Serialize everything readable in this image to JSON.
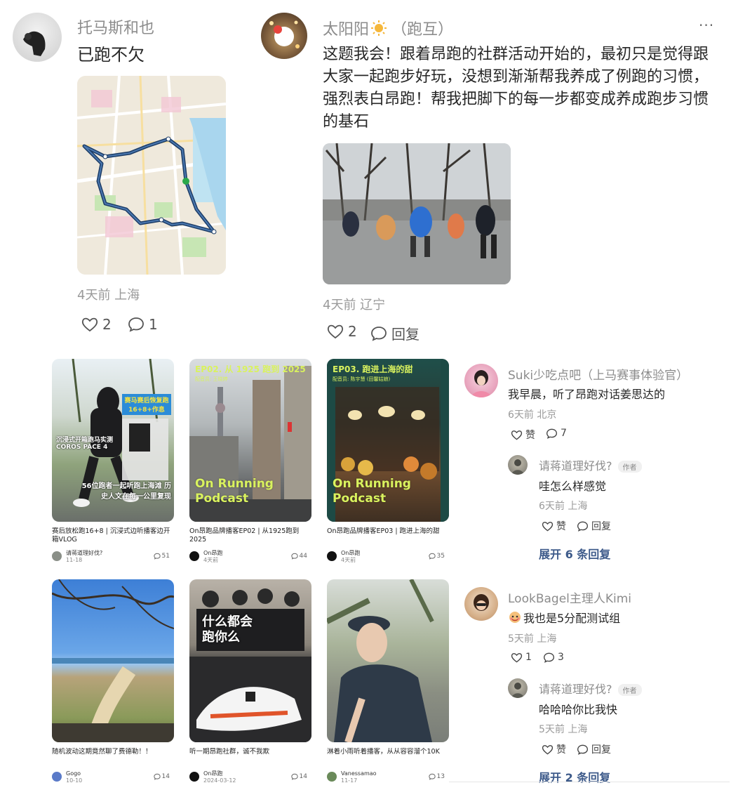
{
  "post1": {
    "username": "托马斯和也",
    "text": "已跑不欠",
    "meta": "4天前 上海",
    "likes": "2",
    "comments": "1"
  },
  "post2": {
    "username": "太阳阳",
    "badge": "（跑互）",
    "more": "···",
    "text": "这题我会！跟着昂跑的社群活动开始的，最初只是觉得跟大家一起跑步好玩，没想到渐渐帮我养成了例跑的习惯，强烈表白昂跑！帮我把脚下的每一步都变成养成跑步习惯的基石",
    "meta": "4天前 辽宁",
    "likes": "2",
    "reply_label": "回复"
  },
  "cards": [
    {
      "title": "赛后放松跑16+8 | 沉浸式边听播客边开箱VLOG",
      "author": "请蒋道理好伐?",
      "date": "11-18",
      "count": "51",
      "overlay_top": "赛马赛后恢复跑16+8+作息",
      "overlay_mid": "沉浸式开箱跑马实测 COROS PACE 4",
      "overlay_bottom": "56位跑者一起听跑上海滩 历史人文在每一公里复现"
    },
    {
      "title": "On昂跑品牌播客EP02 | 从1925跑到2025",
      "author": "On昂跑",
      "date": "4天前",
      "count": "44",
      "ep": "EP02. 从 1925 跑到 2025",
      "ep_sub": "配音员: 王晓婷",
      "podcast_1": "On Running",
      "podcast_2": "Podcast"
    },
    {
      "title": "On昂跑品牌播客EP03 | 跑进上海的甜",
      "author": "On昂跑",
      "date": "4天前",
      "count": "35",
      "ep": "EP03. 跑进上海的甜",
      "ep_sub": "配音员: 陈宇慧 (田馨姑娘)",
      "podcast_1": "On Running",
      "podcast_2": "Podcast"
    },
    {
      "title": "随机波动这期竟然聊了费德勒！！",
      "author": "Gogo",
      "date": "10-10",
      "count": "14"
    },
    {
      "title": "听一期昂跑社群，诚不我欺",
      "author": "On昂跑",
      "date": "2024-03-12",
      "count": "14",
      "overlay": "什么都会 跑你么"
    },
    {
      "title": "淋着小雨听着播客，从从容容溜个10K",
      "author": "Vanessamao",
      "date": "11-17",
      "count": "13"
    }
  ],
  "comments": [
    {
      "username": "Suki少吃点吧（上马赛事体验官）",
      "text": "我早晨，听了昂跑对话姜思达的",
      "meta": "6天前 北京",
      "like_label": "赞",
      "comments": "7",
      "reply": {
        "username": "请蒋道理好伐?",
        "tag": "作者",
        "text": "哇怎么样感觉",
        "meta": "6天前 上海",
        "like_label": "赞",
        "reply_label": "回复"
      },
      "expand": "展开 6 条回复"
    },
    {
      "username": "LookBagel主理人Kimi",
      "text": "我也是5分配测试组",
      "meta": "5天前 上海",
      "likes": "1",
      "comments": "3",
      "reply": {
        "username": "请蒋道理好伐?",
        "tag": "作者",
        "text": "哈哈哈你比我快",
        "meta": "5天前 上海",
        "like_label": "赞",
        "reply_label": "回复"
      },
      "expand": "展开 2 条回复"
    }
  ]
}
